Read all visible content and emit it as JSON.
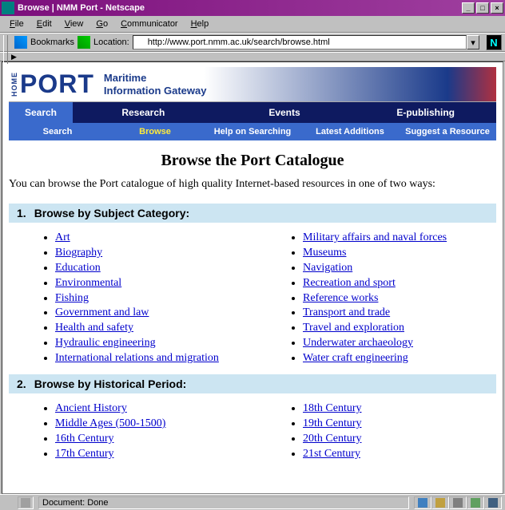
{
  "window": {
    "title": "Browse | NMM Port - Netscape"
  },
  "menubar": [
    "File",
    "Edit",
    "View",
    "Go",
    "Communicator",
    "Help"
  ],
  "toolbar": {
    "bookmarks_label": "Bookmarks",
    "location_label": "Location:",
    "url": "http://www.port.nmm.ac.uk/search/browse.html"
  },
  "header": {
    "home_label": "HOME",
    "logo_text": "PORT",
    "tagline_line1": "Maritime",
    "tagline_line2": "Information Gateway"
  },
  "nav_primary": [
    {
      "label": "Search",
      "active": true
    },
    {
      "label": "Research",
      "active": false
    },
    {
      "label": "Events",
      "active": false
    },
    {
      "label": "E-publishing",
      "active": false
    }
  ],
  "nav_secondary": [
    {
      "label": "Search",
      "current": false
    },
    {
      "label": "Browse",
      "current": true
    },
    {
      "label": "Help on Searching",
      "current": false
    },
    {
      "label": "Latest Additions",
      "current": false
    },
    {
      "label": "Suggest a Resource",
      "current": false
    }
  ],
  "page": {
    "title": "Browse the Port Catalogue",
    "intro": "You can browse the Port catalogue of high quality Internet-based resources in one of two ways:"
  },
  "sections": [
    {
      "num": "1.",
      "label": "Browse by Subject Category:",
      "left": [
        "Art",
        "Biography",
        "Education",
        "Environmental",
        "Fishing",
        "Government and law",
        "Health and safety",
        "Hydraulic engineering",
        "International relations and migration"
      ],
      "right": [
        "Military affairs and naval forces",
        "Museums",
        "Navigation",
        "Recreation and sport",
        "Reference works",
        "Transport and trade",
        "Travel and exploration",
        "Underwater archaeology",
        "Water craft engineering"
      ]
    },
    {
      "num": "2.",
      "label": "Browse by Historical Period:",
      "left": [
        "Ancient History",
        "Middle Ages (500-1500)",
        "16th Century",
        "17th Century"
      ],
      "right": [
        "18th Century",
        "19th Century",
        "20th Century",
        "21st Century"
      ]
    }
  ],
  "statusbar": {
    "text": "Document: Done"
  }
}
